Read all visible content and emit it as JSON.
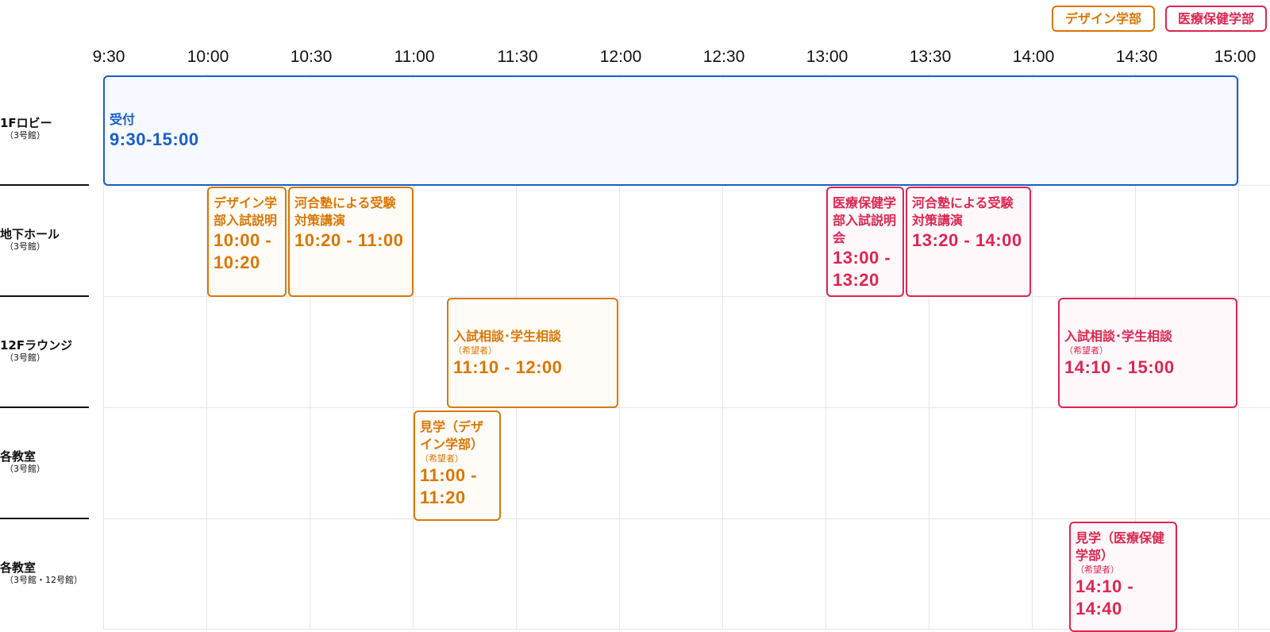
{
  "legend": {
    "design": "デザイン学部",
    "medical": "医療保健学部"
  },
  "timeline": {
    "labels": [
      "9:30",
      "10:00",
      "10:30",
      "11:00",
      "11:30",
      "12:00",
      "12:30",
      "13:00",
      "13:30",
      "14:00",
      "14:30",
      "15:00"
    ]
  },
  "rooms": [
    {
      "name": "1Fロビー",
      "building": "（3号館）"
    },
    {
      "name": "地下ホール",
      "building": "（3号館）"
    },
    {
      "name": "12Fラウンジ",
      "building": "（3号館）"
    },
    {
      "name": "各教室",
      "building": "（3号館）"
    },
    {
      "name": "各教室",
      "building": "（3号館・12号館）"
    }
  ],
  "events": {
    "reception": {
      "title": "受付",
      "time": "9:30-15:00"
    },
    "design_briefing": {
      "title": "デザイン学部入試説明",
      "time": "10:00 - 10:20"
    },
    "kawai_design": {
      "title": "河合塾による受験対策講演",
      "time": "10:20 - 11:00"
    },
    "medical_briefing": {
      "title": "医療保健学部入試説明会",
      "time": "13:00 - 13:20"
    },
    "kawai_medical": {
      "title": "河合塾による受験対策講演",
      "time": "13:20 - 14:00"
    },
    "consult_design": {
      "title": "入試相談･学生相談",
      "note": "（希望者）",
      "time": "11:10 - 12:00"
    },
    "consult_medical": {
      "title": "入試相談･学生相談",
      "note": "（希望者）",
      "time": "14:10 - 15:00"
    },
    "tour_design": {
      "title": "見学（デザイン学部）",
      "note": "（希望者）",
      "time": "11:00 - 11:20"
    },
    "tour_medical": {
      "title": "見学（医療保健学部）",
      "note": "（希望者）",
      "time": "14:10 - 14:40"
    }
  },
  "colors": {
    "design": "#d97706",
    "medical": "#dc2651",
    "reception": "#1a5fc6"
  }
}
